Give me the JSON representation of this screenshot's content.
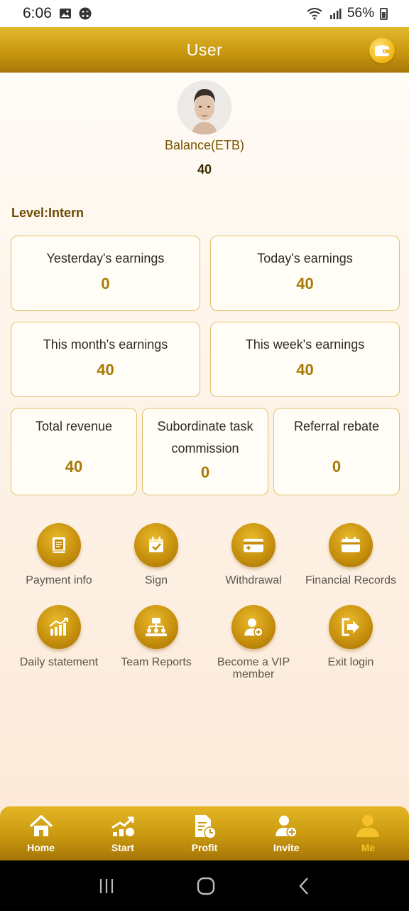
{
  "status": {
    "time": "6:06",
    "battery": "56%"
  },
  "header": {
    "title": "User"
  },
  "profile": {
    "balance_label": "Balance(ETB)",
    "balance_value": "40",
    "level": "Level:Intern"
  },
  "earnings": {
    "yesterday": {
      "label": "Yesterday's earnings",
      "value": "0"
    },
    "today": {
      "label": "Today's earnings",
      "value": "40"
    },
    "month": {
      "label": "This month's earnings",
      "value": "40"
    },
    "week": {
      "label": "This week's earnings",
      "value": "40"
    },
    "total": {
      "label": "Total revenue",
      "value": "40"
    },
    "subordinate": {
      "label1": "Subordinate task",
      "label2": "commission",
      "value": "0"
    },
    "referral": {
      "label": "Referral rebate",
      "value": "0"
    }
  },
  "menu": {
    "payment_info": "Payment info",
    "sign": "Sign",
    "withdrawal": "Withdrawal",
    "financial_records": "Financial Records",
    "daily_statement": "Daily statement",
    "team_reports": "Team Reports",
    "vip_line1": "Become a VIP",
    "vip_line2": "member",
    "exit_login": "Exit login"
  },
  "bottom_nav": {
    "home": "Home",
    "start": "Start",
    "profit": "Profit",
    "invite": "Invite",
    "me": "Me"
  },
  "colors": {
    "accent": "#c9980f",
    "active_tab": "#f6c12a"
  }
}
